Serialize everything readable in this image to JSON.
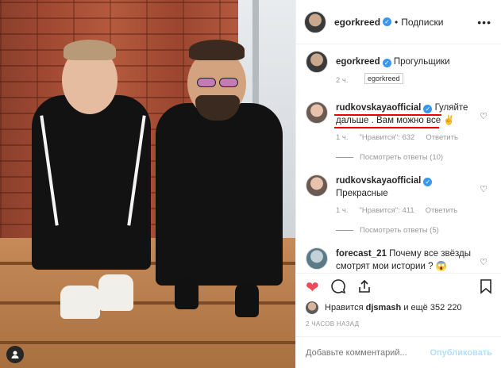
{
  "header": {
    "username": "egorkreed",
    "follow_label": "Подписки"
  },
  "caption": {
    "username": "egorkreed",
    "text": "Прогульщики",
    "time": "2 ч.",
    "tooltip": "egorkreed"
  },
  "comments": [
    {
      "username": "rudkovskayaofficial",
      "text": "Гуляйте дальше . Вам можно все ✌",
      "time": "1 ч.",
      "likes": "\"Нравится\": 632",
      "reply": "Ответить",
      "view_replies": "Посмотреть ответы (10)"
    },
    {
      "username": "rudkovskayaofficial",
      "text": "Прекрасные",
      "time": "1 ч.",
      "likes": "\"Нравится\": 411",
      "reply": "Ответить",
      "view_replies": "Посмотреть ответы (5)"
    },
    {
      "username": "forecast_21",
      "text": "Почему все звёзды смотрят мои истории ? 😱"
    }
  ],
  "likes": {
    "text_prefix": "Нравится",
    "user": "djsmash",
    "text_suffix": "и ещё 352 220"
  },
  "post_time": "2 ЧАСОВ НАЗАД",
  "add_comment": {
    "placeholder": "Добавьте комментарий...",
    "publish_label": "Опубликовать"
  },
  "icons": {
    "heart": "heart-icon",
    "comment": "comment-icon",
    "share": "share-icon",
    "bookmark": "bookmark-icon"
  },
  "colors": {
    "accent": "#3897f0",
    "like": "#ed4956",
    "underline": "#e00000"
  }
}
